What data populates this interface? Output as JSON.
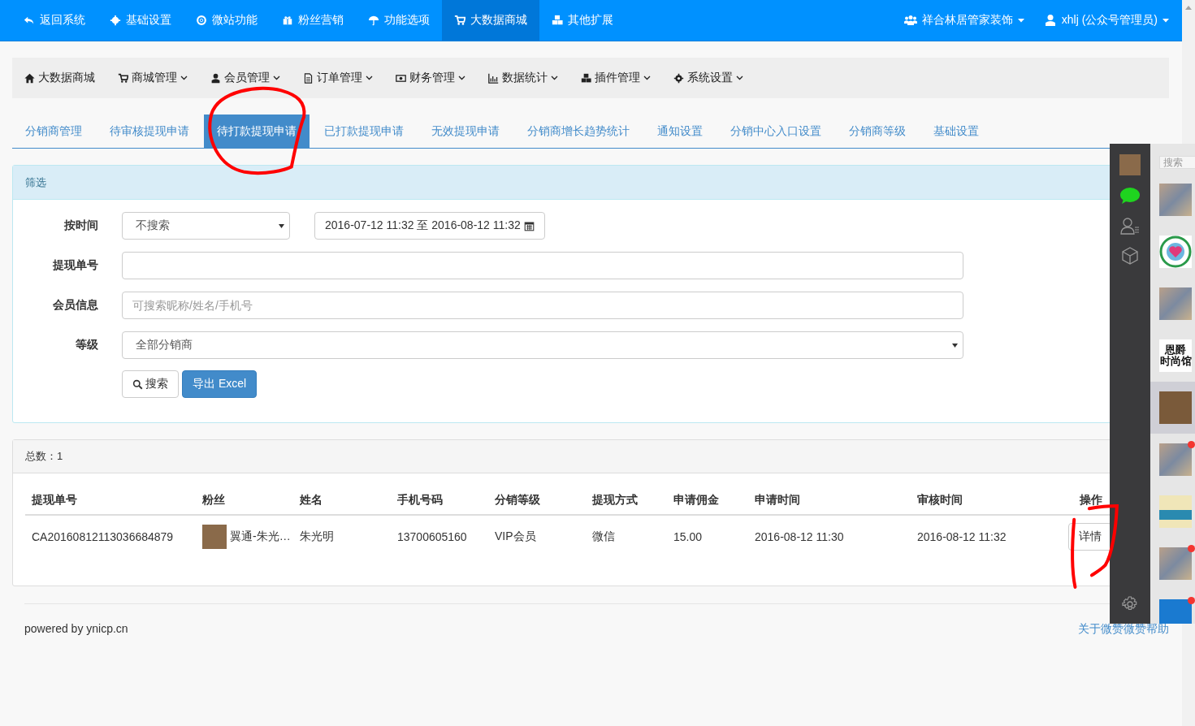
{
  "top_nav": {
    "items": [
      {
        "label": "返回系统",
        "selected": false
      },
      {
        "label": "基础设置",
        "selected": false
      },
      {
        "label": "微站功能",
        "selected": false
      },
      {
        "label": "粉丝营销",
        "selected": false
      },
      {
        "label": "功能选项",
        "selected": false
      },
      {
        "label": "大数据商城",
        "selected": true
      },
      {
        "label": "其他扩展",
        "selected": false
      }
    ],
    "account": [
      {
        "label": "祥合林居管家装饰"
      },
      {
        "label": "xhlj (公众号管理员)"
      }
    ]
  },
  "sub_nav": {
    "items": [
      {
        "label": "大数据商城",
        "has_menu": false
      },
      {
        "label": "商城管理",
        "has_menu": true
      },
      {
        "label": "会员管理",
        "has_menu": true
      },
      {
        "label": "订单管理",
        "has_menu": true
      },
      {
        "label": "财务管理",
        "has_menu": true
      },
      {
        "label": "数据统计",
        "has_menu": true
      },
      {
        "label": "插件管理",
        "has_menu": true
      },
      {
        "label": "系统设置",
        "has_menu": true
      }
    ]
  },
  "tabs": [
    {
      "label": "分销商管理",
      "selected": false
    },
    {
      "label": "待审核提现申请",
      "selected": false
    },
    {
      "label": "待打款提现申请",
      "selected": true
    },
    {
      "label": "已打款提现申请",
      "selected": false
    },
    {
      "label": "无效提现申请",
      "selected": false
    },
    {
      "label": "分销商增长趋势统计",
      "selected": false
    },
    {
      "label": "通知设置",
      "selected": false
    },
    {
      "label": "分销中心入口设置",
      "selected": false
    },
    {
      "label": "分销商等级",
      "selected": false
    },
    {
      "label": "基础设置",
      "selected": false
    }
  ],
  "filter": {
    "title": "筛选",
    "time": {
      "label": "按时间",
      "value": "不搜索",
      "range": "2016-07-12 11:32 至 2016-08-12 11:32"
    },
    "order_no": {
      "label": "提现单号"
    },
    "member": {
      "label": "会员信息",
      "placeholder": "可搜索昵称/姓名/手机号"
    },
    "level": {
      "label": "等级",
      "value": "全部分销商"
    },
    "buttons": {
      "search": "搜索",
      "export": "导出 Excel"
    }
  },
  "results": {
    "total": "总数：1",
    "table": {
      "columns": [
        "提现单号",
        "粉丝",
        "姓名",
        "手机号码",
        "分销等级",
        "提现方式",
        "申请佣金",
        "申请时间",
        "审核时间",
        "操作"
      ],
      "rows": [
        {
          "order_no": "CA20160812113036684879",
          "fan": "翼通-朱光…",
          "name": "朱光明",
          "phone": "13700605160",
          "level": "VIP会员",
          "method": "微信",
          "amount": "15.00",
          "applied": "2016-08-12 11:30",
          "reviewed": "2016-08-12 11:32",
          "action": "详情"
        }
      ]
    }
  },
  "footer": {
    "powered": "powered by ynicp.cn",
    "help_link": "关于微赞微赞帮助"
  },
  "chat_panel": {
    "search": {
      "placeholder": "搜索"
    },
    "conversations": [
      {
        "kind": "group",
        "selected": false,
        "unread": false
      },
      {
        "kind": "logo",
        "selected": false,
        "unread": false
      },
      {
        "kind": "group",
        "selected": false,
        "unread": false
      },
      {
        "kind": "text",
        "lines": [
          "恩爵",
          "时尚馆"
        ],
        "selected": false,
        "unread": false
      },
      {
        "kind": "photo",
        "selected": true,
        "unread": false
      },
      {
        "kind": "group",
        "selected": false,
        "unread": true
      },
      {
        "kind": "banner",
        "selected": false,
        "unread": false
      },
      {
        "kind": "group",
        "selected": false,
        "unread": true
      },
      {
        "kind": "blue",
        "selected": false,
        "unread": true
      }
    ]
  },
  "annotations": [
    {
      "kind": "circle"
    },
    {
      "kind": "bracket"
    }
  ]
}
